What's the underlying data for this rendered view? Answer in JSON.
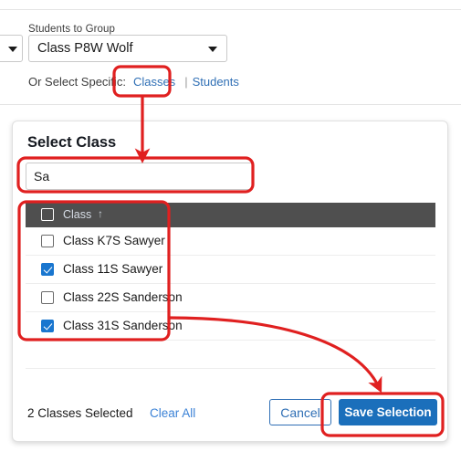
{
  "form": {
    "field_label": "Students to Group",
    "selected_class": "Class P8W Wolf",
    "or_select_prefix": "Or Select Specific:",
    "link_classes": "Classes",
    "link_separator": "|",
    "link_students": "Students"
  },
  "dialog": {
    "title": "Select Class",
    "search_value": "Sa",
    "search_placeholder": "",
    "column_header": "Class",
    "sort_indicator": "↑",
    "rows": [
      {
        "label": "Class K7S Sawyer",
        "checked": false
      },
      {
        "label": "Class 11S Sawyer",
        "checked": true
      },
      {
        "label": "Class 22S Sanderson",
        "checked": false
      },
      {
        "label": "Class 31S Sanderson",
        "checked": true
      }
    ],
    "footer": {
      "count_text": "2 Classes Selected",
      "clear_all": "Clear All",
      "cancel": "Cancel",
      "save": "Save Selection"
    }
  },
  "annotation": {
    "color": "#e02020",
    "stroke_width": 3.2,
    "shapes": [
      {
        "name": "highlight-classes-link",
        "type": "rounded-rect"
      },
      {
        "name": "highlight-search-box",
        "type": "rounded-rect"
      },
      {
        "name": "highlight-class-list",
        "type": "rounded-rect"
      },
      {
        "name": "highlight-save-button",
        "type": "rounded-rect"
      },
      {
        "name": "arrow-classes-to-search",
        "type": "arrow"
      },
      {
        "name": "arrow-list-to-save",
        "type": "curved-arrow"
      }
    ]
  },
  "colors": {
    "accent_blue": "#1b6fbb",
    "link_blue": "#2f6fb5",
    "header_bar": "#4f4f4f",
    "annotation_red": "#e02020",
    "checkbox_checked": "#1976cf"
  }
}
